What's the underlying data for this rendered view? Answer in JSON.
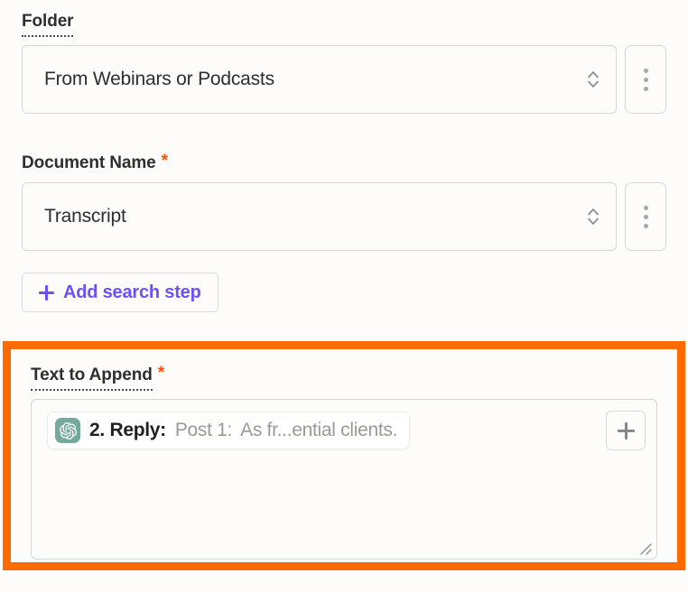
{
  "fields": {
    "folder": {
      "label": "Folder",
      "required": false,
      "dotted_underline": true,
      "value": "From Webinars or Podcasts",
      "dropdown_icon": "chevron-up-down-icon",
      "menu_icon": "kebab-menu-icon"
    },
    "document_name": {
      "label": "Document Name",
      "required": true,
      "required_marker": "*",
      "dotted_underline": false,
      "value": "Transcript",
      "dropdown_icon": "chevron-up-down-icon",
      "menu_icon": "kebab-menu-icon"
    },
    "text_to_append": {
      "label": "Text to Append",
      "required": true,
      "required_marker": "*",
      "dotted_underline": true,
      "token": {
        "app_icon": "openai-logo-icon",
        "step_label": "2. Reply:",
        "preview_prefix": "Post 1:",
        "preview_value": "As fr...ential clients."
      },
      "add_token_label": "+",
      "add_token_icon": "plus-icon",
      "resize_icon": "resize-grip-icon"
    }
  },
  "buttons": {
    "add_search_step": {
      "label": "Add search step",
      "icon": "plus-icon"
    }
  },
  "colors": {
    "highlight_border": "#FF6B00",
    "accent_purple": "#6B52F4",
    "required_asterisk": "#FF4F00",
    "openai_green": "#74AA9C",
    "page_background": "#FDFCFA",
    "control_border": "#D8D6D1",
    "placeholder_text": "#9B9994"
  }
}
